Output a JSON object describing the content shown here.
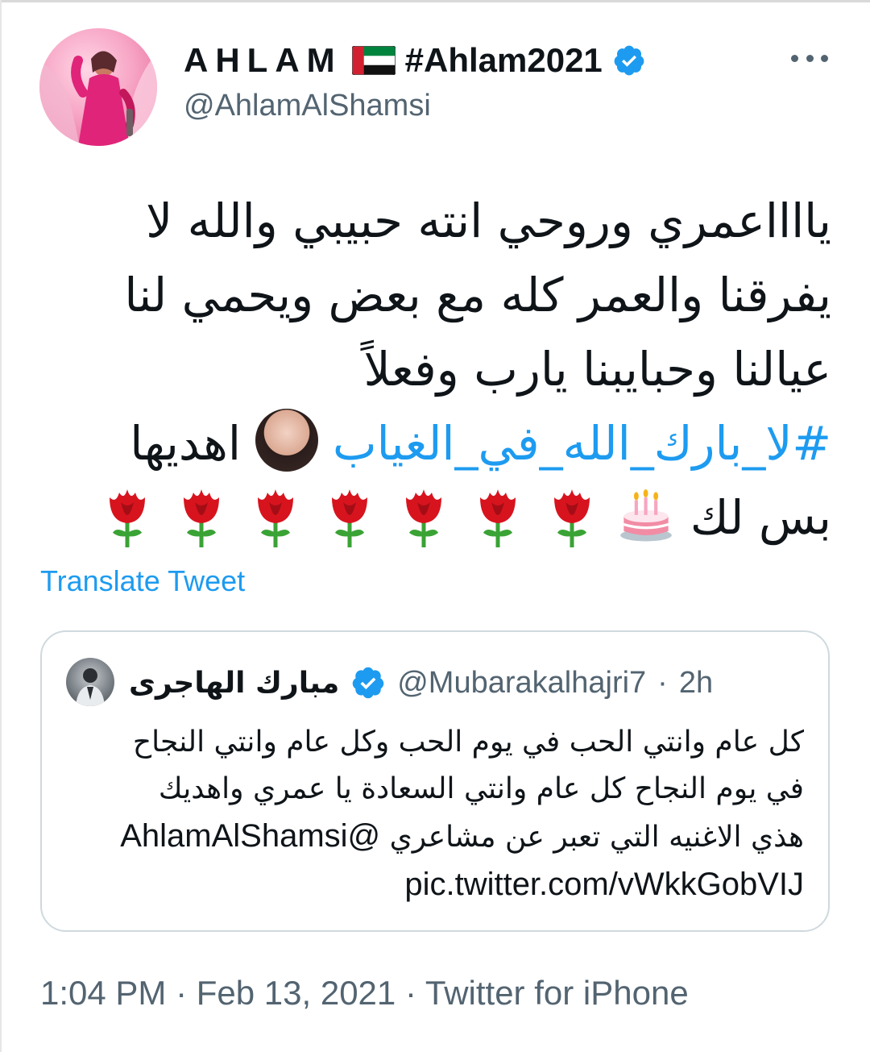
{
  "tweet": {
    "author": {
      "display_name": "AHLAM",
      "display_hashtag": "#Ahlam2021",
      "flag": "uae-flag",
      "verified": true,
      "handle": "@AhlamAlShamsi"
    },
    "text_lines": [
      "يااااعمري وروحي انته حبيبي والله لا",
      "يفرقنا والعمر كله مع بعض ويحمي لنا",
      "عيالنا وحبايبنا يارب وفعلاً"
    ],
    "hashtag": "#لا_بارك_الله_في_الغياب",
    "hashtag_suffix": "اهديها",
    "last_line_text": "بس لك",
    "emojis": [
      "birthday-cake",
      "rose",
      "rose",
      "rose",
      "rose",
      "rose",
      "rose",
      "rose"
    ],
    "translate_label": "Translate Tweet",
    "timestamp": "1:04 PM · Feb 13, 2021",
    "source": "Twitter for iPhone"
  },
  "quoted_tweet": {
    "display_name": "مبارك الهاجرى",
    "verified": true,
    "handle": "@Mubarakalhajri7",
    "time_ago": "2h",
    "text_lines": [
      "كل عام وانتي الحب في يوم الحب وكل عام وانتي النجاح",
      "في يوم النجاح كل عام وانتي السعادة يا عمري واهديك",
      "هذي الاغنيه التي تعبر عن مشاعري"
    ],
    "mention": "@AhlamAlShamsi",
    "link": "pic.twitter.com/vWkkGobVIJ"
  },
  "colors": {
    "accent": "#1d9bf0",
    "secondary_text": "#536471",
    "border": "#cfd9de"
  }
}
